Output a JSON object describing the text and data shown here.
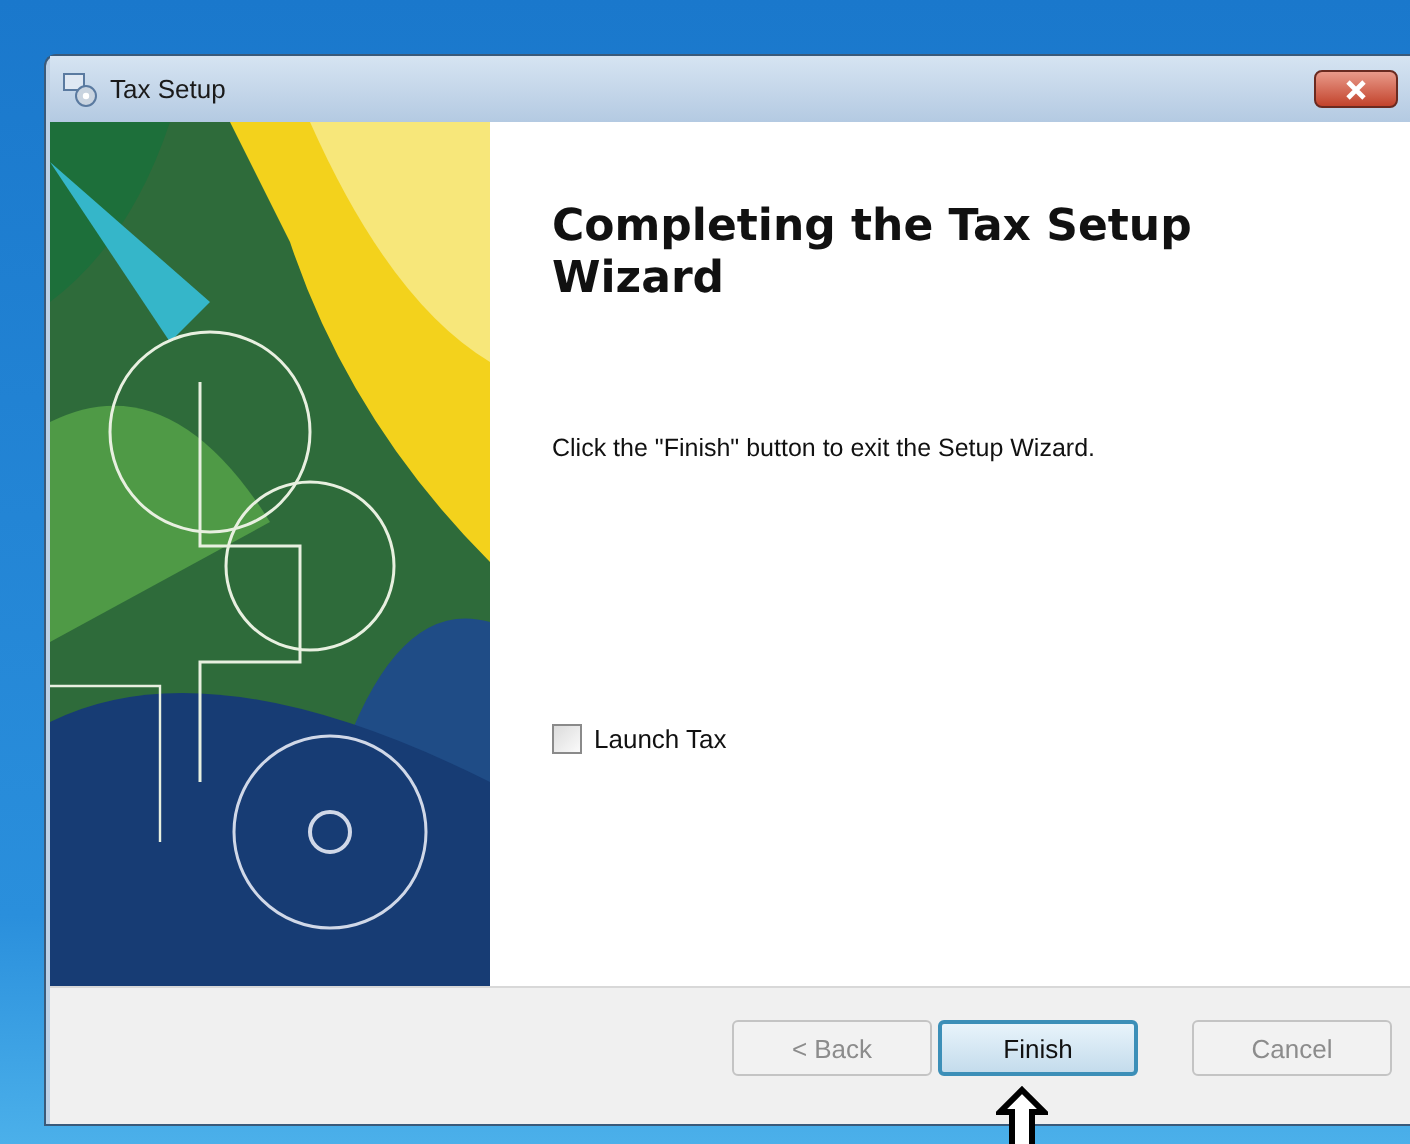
{
  "window": {
    "title": "Tax Setup"
  },
  "heading": "Completing the Tax Setup Wizard",
  "message": "Click the \"Finish\" button to exit the Setup Wizard.",
  "launch_option": {
    "label": "Launch Tax",
    "checked": false
  },
  "buttons": [
    {
      "label": "< Back",
      "disabled": true,
      "focused": false
    },
    {
      "label": "Finish",
      "disabled": false,
      "focused": true
    },
    {
      "label": "Cancel",
      "disabled": true,
      "focused": false
    }
  ]
}
